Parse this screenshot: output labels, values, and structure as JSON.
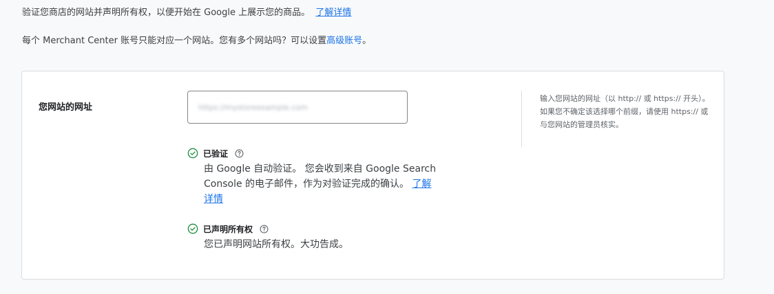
{
  "intro": {
    "line1_text": "验证您商店的网站并声明所有权，以便开始在 Google 上展示您的商品。",
    "line1_link": "了解详情",
    "line2_text": "每个 Merchant Center 账号只能对应一个网站。您有多个网站吗？可以设置",
    "line2_link": "高级账号",
    "line2_end": "。"
  },
  "website_card": {
    "field_label": "您网站的网址",
    "url_value": "https://mystoreexample.com",
    "help_text": "输入您网站的网址（以 http:// 或 https:// 开头）。如果您不确定该选择哪个前缀，请使用 https:// 或与您网站的管理员核实。"
  },
  "verified": {
    "title": "已验证",
    "body": "由 Google 自动验证。 您会收到来自 Google Search Console 的电子邮件，作为对验证完成的确认。",
    "link": "了解详情"
  },
  "claimed": {
    "title": "已声明所有权",
    "body": "您已声明网站所有权。大功告成。"
  },
  "icons": {
    "check": "check-circle-icon",
    "help": "help-circle-icon"
  },
  "colors": {
    "success": "#1e8e3e",
    "link": "#1a73e8"
  }
}
